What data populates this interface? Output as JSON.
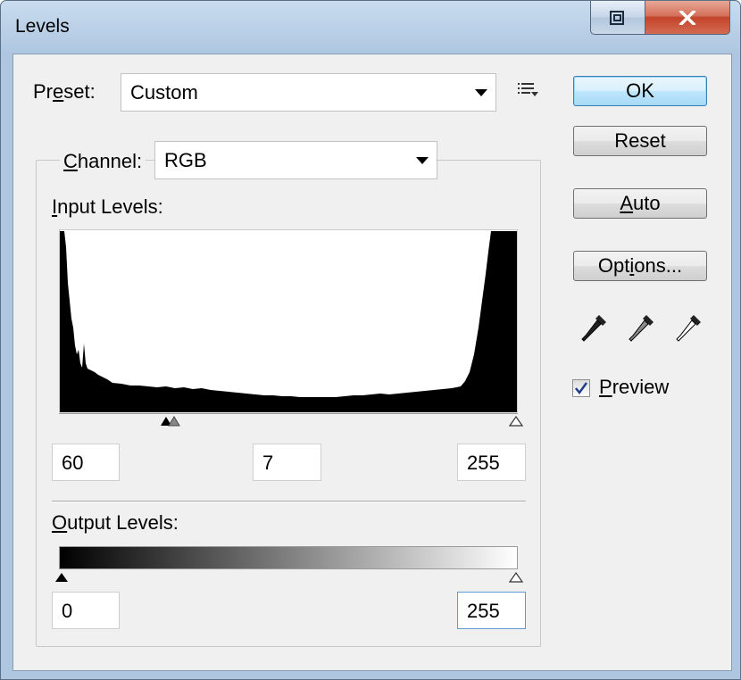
{
  "window": {
    "title": "Levels"
  },
  "preset": {
    "label_pre": "Pr",
    "label_ul": "e",
    "label_post": "set:",
    "value": "Custom"
  },
  "channel": {
    "label_ul": "C",
    "label_post": "hannel:",
    "value": "RGB"
  },
  "input_levels": {
    "label_pre": "",
    "label_ul": "I",
    "label_post": "nput Levels:",
    "shadow": "60",
    "midtone": "7",
    "highlight": "255"
  },
  "output_levels": {
    "label_ul": "O",
    "label_post": "utput Levels:",
    "shadow": "0",
    "highlight": "255"
  },
  "buttons": {
    "ok": "OK",
    "reset": "Reset",
    "auto_ul": "A",
    "auto_post": "uto",
    "options_pre": "Opt",
    "options_ul": "i",
    "options_post": "ons..."
  },
  "preview": {
    "label_ul": "P",
    "label_post": "review",
    "checked": true
  },
  "icons": [
    "preset-menu-icon",
    "black-eyedropper-icon",
    "gray-eyedropper-icon",
    "white-eyedropper-icon",
    "close-icon",
    "restore-icon"
  ]
}
